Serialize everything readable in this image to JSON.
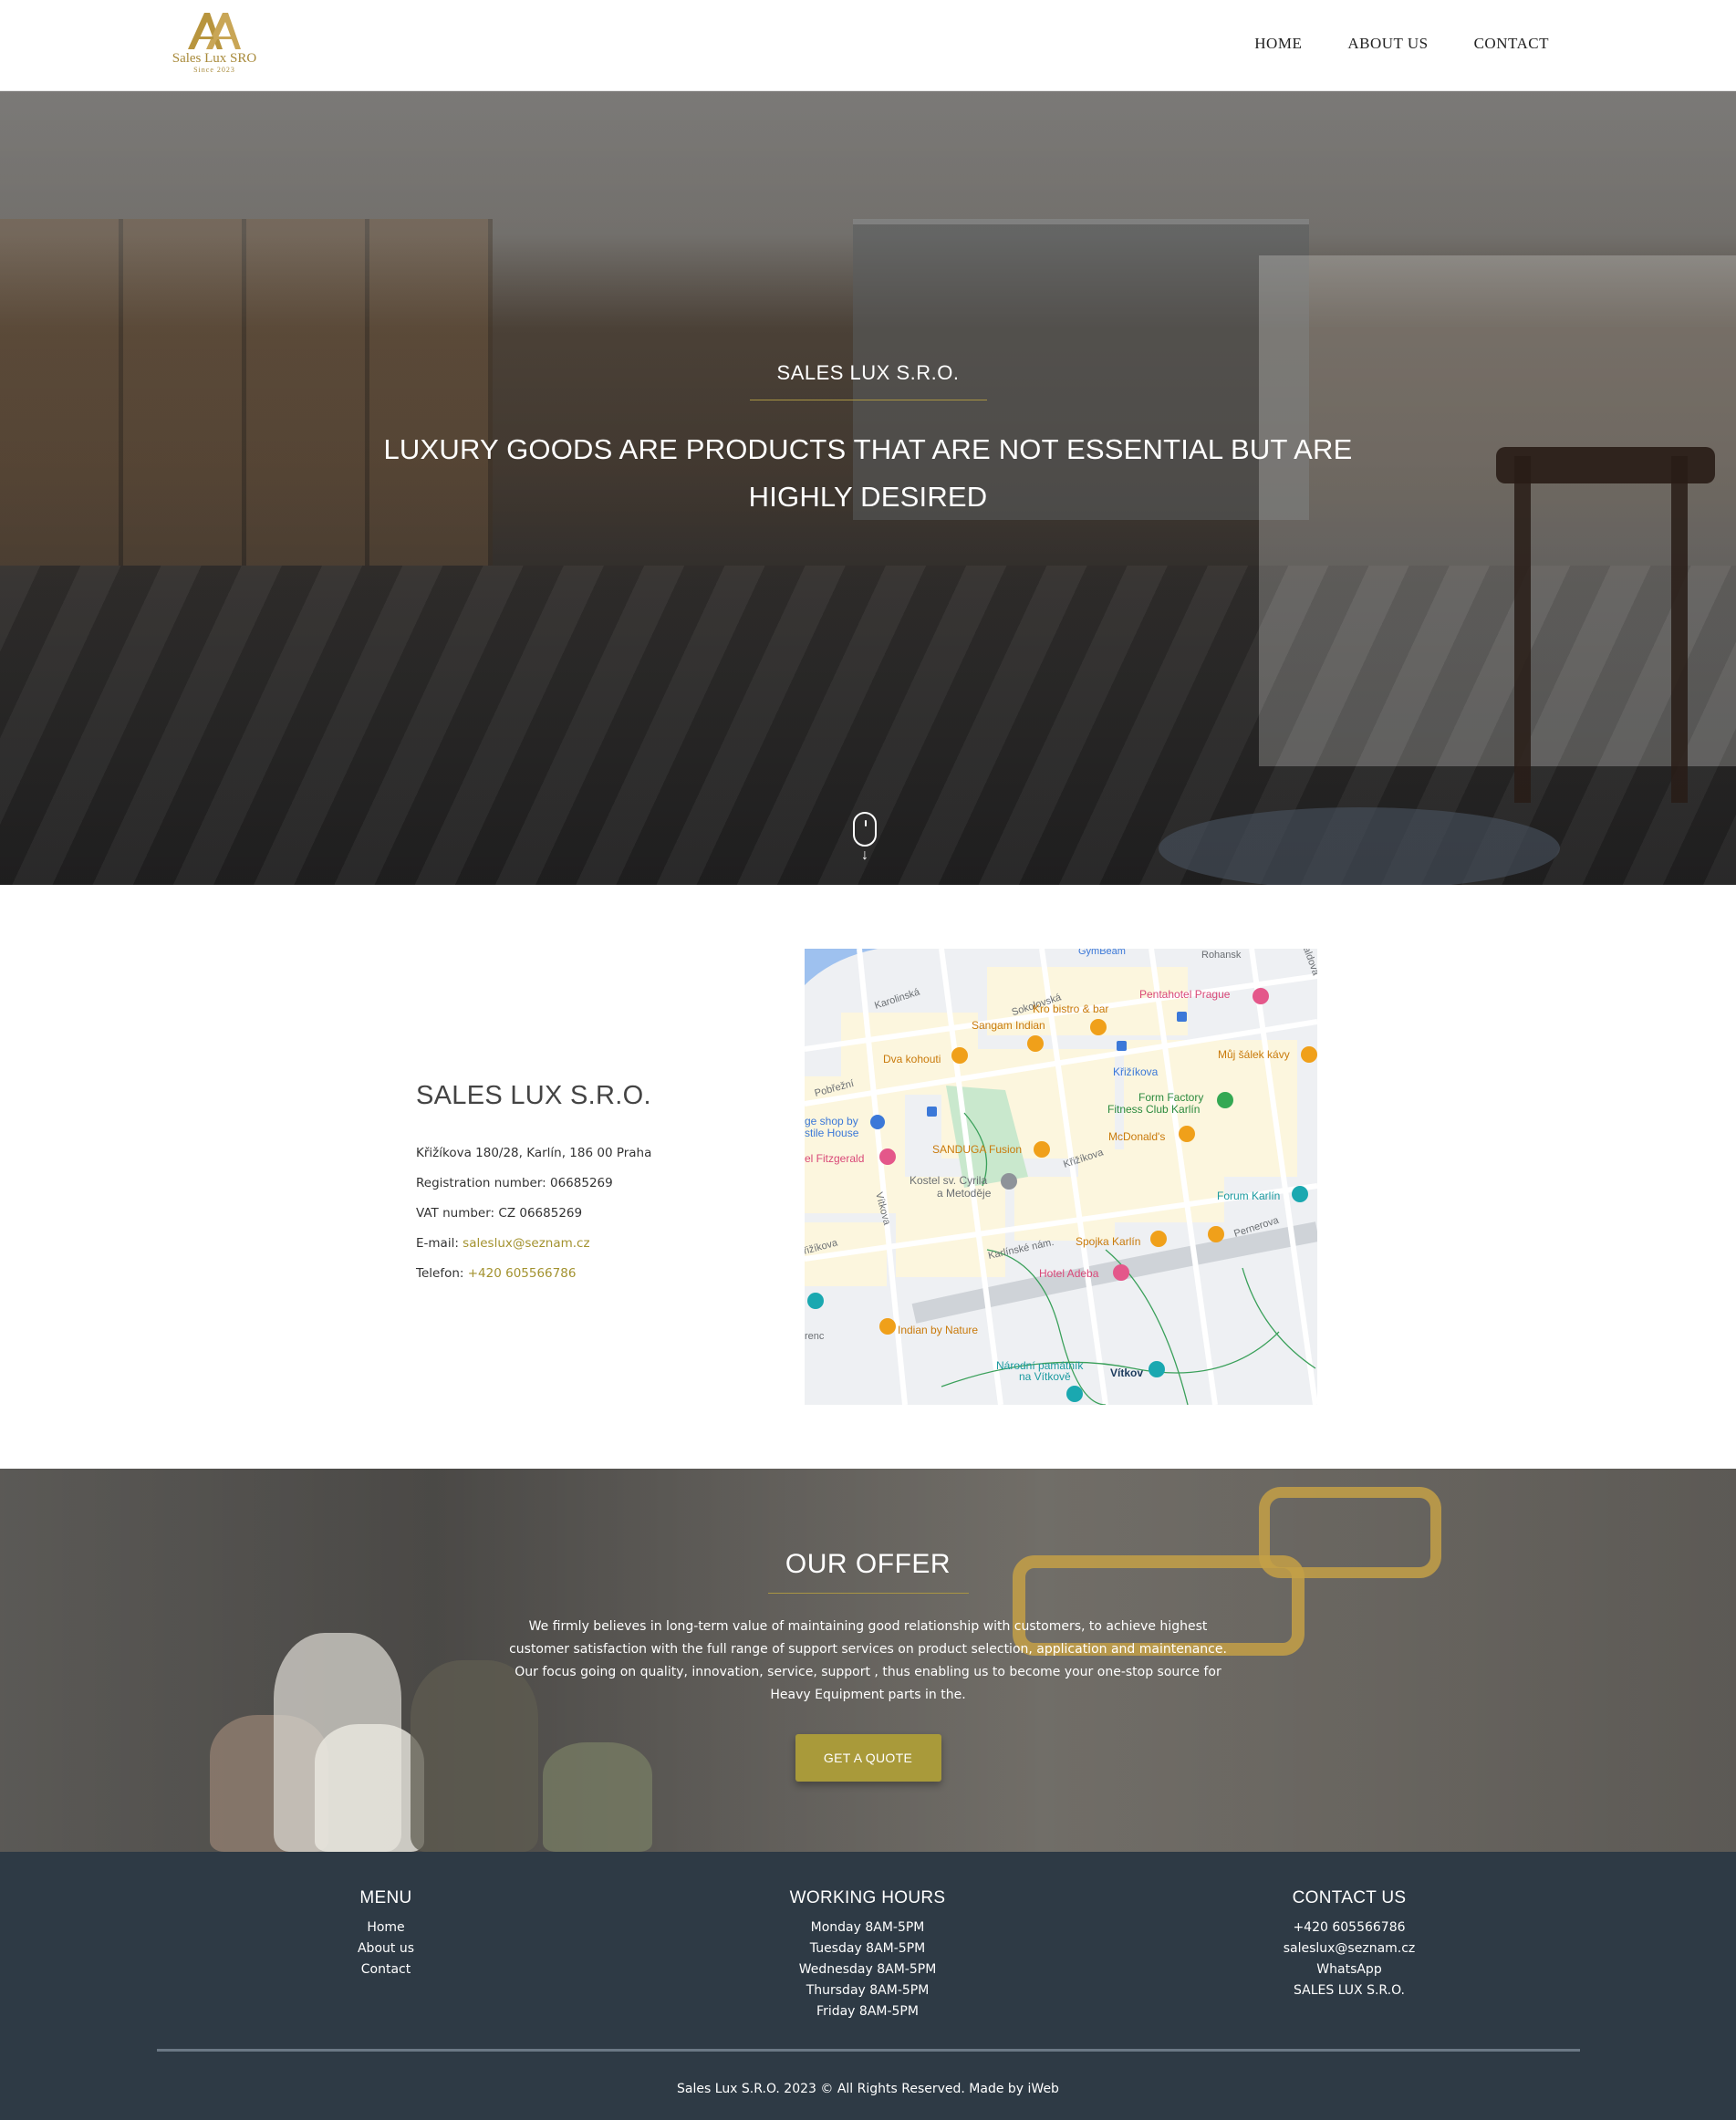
{
  "brand": {
    "logo_text": "Sales Lux SRO",
    "logo_since": "Since 2023",
    "accent": "#a99543"
  },
  "nav": {
    "items": [
      {
        "label": "HOME"
      },
      {
        "label": "ABOUT US"
      },
      {
        "label": "CONTACT"
      }
    ]
  },
  "hero": {
    "kicker": "SALES LUX S.R.O.",
    "title": "LUXURY GOODS ARE PRODUCTS THAT ARE NOT ESSENTIAL BUT ARE HIGHLY DESIRED",
    "scroll_icon": "mouse-scroll-icon"
  },
  "company": {
    "title": "SALES LUX S.R.O.",
    "address": "Křižíkova 180/28, Karlín, 186 00 Praha",
    "registration_label": "Registration number:",
    "registration_value": "06685269",
    "vat_label": "VAT number:",
    "vat_value": "CZ 06685269",
    "email_label": "E-mail:",
    "email_value": "saleslux@seznam.cz",
    "phone_label": "Telefon:",
    "phone_value": "+420 605566786"
  },
  "map": {
    "labels": {
      "gymbeam": "GymBeam",
      "rohanske": "Rohansk",
      "saldova": "Šaldova",
      "karolinska": "Karolinská",
      "kro_bistro": "Kro bistro & bar",
      "pentahotel": "Pentahotel Prague",
      "sangam": "Sangam Indian",
      "dva_kohouti": "Dva kohouti",
      "sokolovska": "Sokolovská",
      "krizikova_metro": "Křižíkova",
      "muj_salek": "Můj šálek kávy",
      "pobrezni": "Pobřežní",
      "form_factory_1": "Form Factory",
      "form_factory_2": "Fitness Club Karlín",
      "shop_1": "ge shop by",
      "shop_2": "stile House",
      "mcdonalds": "McDonald's",
      "fitzgerald": "el Fitzgerald",
      "sanduga": "SANDUGA Fusion",
      "krizikova_street": "Křižíkova",
      "kostel_1": "Kostel sv. Cyrila",
      "kostel_2": "a Metoděje",
      "vitkova": "Vítkova",
      "forum": "Forum Karlín",
      "krizikova_left": "řižíkova",
      "karlinske_nam": "Karlínské nám.",
      "spojka": "Spojka Karlín",
      "pernerova": "Pernerova",
      "hotel_adeba": "Hotel Adeba",
      "florenc": "renc",
      "indian_nature": "Indian by Nature",
      "narodni_1": "Národní památník",
      "narodni_2": "na Vítkově",
      "vitkov": "Vítkov"
    }
  },
  "offer": {
    "title": "OUR OFFER",
    "text": "We firmly believes in long-term value of maintaining good relationship with customers, to achieve highest customer satisfaction with the full range of support services on product selection, application and maintenance. Our focus going on quality, innovation, service, support , thus enabling us to become your one-stop source for Heavy Equipment parts in the.",
    "button": "GET A QUOTE"
  },
  "footer": {
    "menu": {
      "title": "MENU",
      "items": [
        "Home",
        "About us",
        "Contact"
      ]
    },
    "hours": {
      "title": "WORKING HOURS",
      "items": [
        "Monday 8AM-5PM",
        "Tuesday 8AM-5PM",
        "Wednesday 8AM-5PM",
        "Thursday 8AM-5PM",
        "Friday 8AM-5PM"
      ]
    },
    "contact": {
      "title": "CONTACT US",
      "items": [
        "+420 605566786",
        "saleslux@seznam.cz",
        "WhatsApp",
        "SALES LUX S.R.O."
      ]
    },
    "copyright": "Sales Lux S.R.O. 2023 © All Rights Reserved. Made by iWeb",
    "background": "#2e3a45"
  }
}
